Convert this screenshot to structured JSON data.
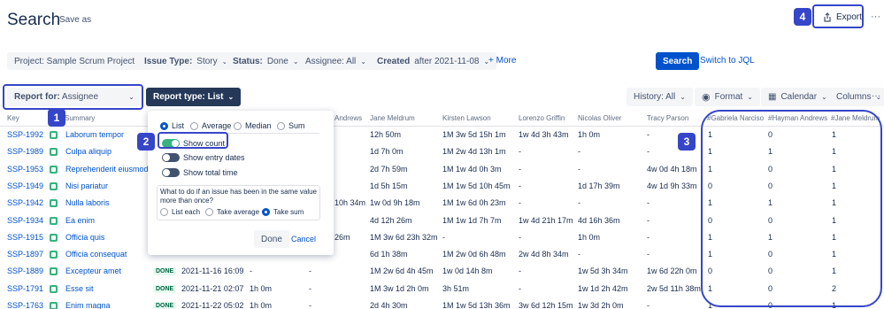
{
  "header": {
    "title": "Search",
    "save_as": "Save as",
    "export": "Export",
    "more": "···"
  },
  "filters": {
    "project": "Project: Sample Scrum Project",
    "issue_type_label": "Issue Type:",
    "issue_type_value": "Story",
    "status_label": "Status:",
    "status_value": "Done",
    "assignee": "Assignee: All",
    "created_label": "Created",
    "created_value": "after 2021-11-08",
    "more": "+ More",
    "search": "Search",
    "switch_jql": "Switch to JQL"
  },
  "toolbar": {
    "report_for_label": "Report for:",
    "report_for_value": "Assignee",
    "report_type": "Report type: List",
    "history": "History: All",
    "format": "Format",
    "calendar": "Calendar",
    "columns": "Columns",
    "more": "···"
  },
  "callouts": [
    "1",
    "2",
    "3",
    "4"
  ],
  "columns": {
    "key": "Key",
    "t": "T",
    "summary": "Summary",
    "andrews": "Andrews",
    "meldrum": "Jane Meldrum",
    "lawson": "Kirsten Lawson",
    "griffin": "Lorenzo Griffin",
    "oliver": "Nicolas Oliver",
    "parson": "Tracy Parson",
    "c_narciso": "#Gabriela Narciso",
    "c_andrews": "#Hayman Andrews",
    "c_meldrum": "#Jane Meldrum"
  },
  "popup": {
    "mode_list": "List",
    "mode_average": "Average",
    "mode_median": "Median",
    "mode_sum": "Sum",
    "show_count": "Show count",
    "show_entry_dates": "Show entry dates",
    "show_total_time": "Show total time",
    "question": "What to do if an issue has been in the same value more than once?",
    "list_each": "List each",
    "take_average": "Take average",
    "take_sum": "Take sum",
    "done": "Done",
    "cancel": "Cancel"
  },
  "rows": [
    {
      "key": "SSP-1992",
      "summary": "Laborum tempor",
      "status": "",
      "created": "",
      "c1": "",
      "c2": "",
      "andrews": "",
      "meldrum": "12h 50m",
      "lawson": "1M 3w 5d 15h 1m",
      "griffin": "1w 4d 3h 43m",
      "oliver": "1h 0m",
      "parson": "-",
      "n1": "1",
      "n2": "0",
      "n3": "1"
    },
    {
      "key": "SSP-1989",
      "summary": "Culpa aliquip",
      "status": "",
      "created": "",
      "c1": "",
      "c2": "",
      "andrews": "",
      "meldrum": "1d 7h 0m",
      "lawson": "1M 2w 4d 13h 1m",
      "griffin": "-",
      "oliver": "-",
      "parson": "-",
      "n1": "1",
      "n2": "1",
      "n3": "1"
    },
    {
      "key": "SSP-1953",
      "summary": "Reprehenderit eiusmod",
      "status": "",
      "created": "",
      "c1": "",
      "c2": "",
      "andrews": "",
      "meldrum": "2d 7h 59m",
      "lawson": "1M 1w 4d 0h 3m",
      "griffin": "-",
      "oliver": "-",
      "parson": "4w 0d 4h 18m",
      "n1": "1",
      "n2": "0",
      "n3": "1"
    },
    {
      "key": "SSP-1949",
      "summary": "Nisi pariatur",
      "status": "",
      "created": "",
      "c1": "",
      "c2": "",
      "andrews": "",
      "meldrum": "1d 5h 15m",
      "lawson": "1M 1w 5d 10h 45m",
      "griffin": "-",
      "oliver": "1d 17h 39m",
      "parson": "4w 1d 9h 33m",
      "n1": "0",
      "n2": "0",
      "n3": "1"
    },
    {
      "key": "SSP-1942",
      "summary": "Nulla laboris",
      "status": "",
      "created": "",
      "c1": "",
      "c2": "",
      "andrews": "10h 34m",
      "meldrum": "1w 0d 9h 18m",
      "lawson": "1M 1w 6d 0h 23m",
      "griffin": "-",
      "oliver": "-",
      "parson": "-",
      "n1": "1",
      "n2": "1",
      "n3": "1"
    },
    {
      "key": "SSP-1934",
      "summary": "Ea enim",
      "status": "",
      "created": "",
      "c1": "",
      "c2": "",
      "andrews": "",
      "meldrum": "4d 12h 26m",
      "lawson": "1M 1w 1d 7h 7m",
      "griffin": "1w 4d 21h 17m",
      "oliver": "4d 16h 36m",
      "parson": "-",
      "n1": "0",
      "n2": "0",
      "n3": "1"
    },
    {
      "key": "SSP-1915",
      "summary": "Officia quis",
      "status": "",
      "created": "",
      "c1": "",
      "c2": "",
      "andrews": "26m",
      "meldrum": "1M 3w 6d 23h 32m",
      "lawson": "-",
      "griffin": "-",
      "oliver": "1h 0m",
      "parson": "-",
      "n1": "1",
      "n2": "1",
      "n3": "1"
    },
    {
      "key": "SSP-1897",
      "summary": "Officia consequat",
      "status": "",
      "created": "",
      "c1": "",
      "c2": "",
      "andrews": "",
      "meldrum": "6d 1h 38m",
      "lawson": "1M 2w 0d 6h 48m",
      "griffin": "2w 4d 8h 34m",
      "oliver": "-",
      "parson": "-",
      "n1": "1",
      "n2": "0",
      "n3": "1"
    },
    {
      "key": "SSP-1889",
      "summary": "Excepteur amet",
      "status": "DONE",
      "created": "2021-11-16 16:09",
      "c1": "-",
      "c2": "-",
      "andrews": "",
      "meldrum": "1M 2w 6d 4h 45m",
      "lawson": "1w 0d 14h 8m",
      "griffin": "-",
      "oliver": "1w 5d 3h 34m",
      "parson": "1w 6d 22h 0m",
      "n1": "0",
      "n2": "0",
      "n3": "1"
    },
    {
      "key": "SSP-1791",
      "summary": "Esse sit",
      "status": "DONE",
      "created": "2021-11-21 02:07",
      "c1": "1h 0m",
      "c2": "-",
      "andrews": "",
      "meldrum": "1M 3w 1d 2h 0m",
      "lawson": "3h 51m",
      "griffin": "-",
      "oliver": "1w 1d 2h 42m",
      "parson": "2w 5d 11h 38m",
      "n1": "1",
      "n2": "0",
      "n3": "2"
    },
    {
      "key": "SSP-1763",
      "summary": "Enim magna",
      "status": "DONE",
      "created": "2021-11-22 05:02",
      "c1": "1h 0m",
      "c2": "-",
      "andrews": "",
      "meldrum": "2d 4h 30m",
      "lawson": "1M 1w 5d 13h 36m",
      "griffin": "3w 6d 12h 15m",
      "oliver": "1w 3d 2h 0m",
      "parson": "-",
      "n1": "1",
      "n2": "0",
      "n3": "1"
    }
  ]
}
